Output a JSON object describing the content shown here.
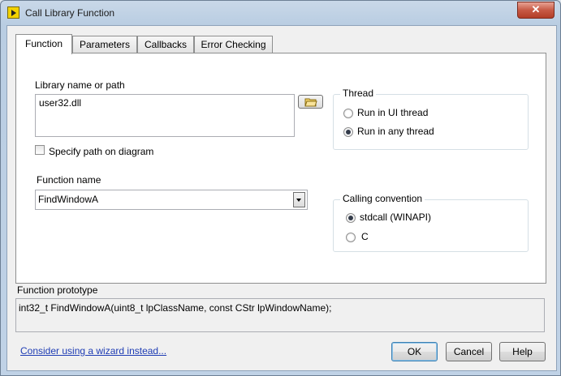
{
  "window": {
    "title": "Call Library Function",
    "close_label": "✕"
  },
  "tabs": [
    {
      "label": "Function"
    },
    {
      "label": "Parameters"
    },
    {
      "label": "Callbacks"
    },
    {
      "label": "Error Checking"
    }
  ],
  "library": {
    "label": "Library name or path",
    "value": "user32.dll",
    "specify_path_label": "Specify path on diagram",
    "specify_path_checked": false
  },
  "function": {
    "label": "Function name",
    "value": "FindWindowA"
  },
  "thread": {
    "title": "Thread",
    "options": [
      {
        "label": "Run in UI thread",
        "checked": false
      },
      {
        "label": "Run in any thread",
        "checked": true
      }
    ]
  },
  "calling_convention": {
    "title": "Calling convention",
    "options": [
      {
        "label": "stdcall (WINAPI)",
        "checked": true
      },
      {
        "label": "C",
        "checked": false
      }
    ]
  },
  "prototype": {
    "label": "Function prototype",
    "value": "int32_t FindWindowA(uint8_t lpClassName, const CStr lpWindowName);"
  },
  "footer": {
    "wizard_link": "Consider using a wizard instead...",
    "ok_label": "OK",
    "cancel_label": "Cancel",
    "help_label": "Help"
  },
  "colors": {
    "accent": "#3c7fb1",
    "link": "#1e3cb4",
    "title_bar": "#c9d8e8"
  },
  "icons": {
    "app": "labview-icon",
    "folder": "folder-icon",
    "dropdown": "chevron-down-icon"
  }
}
